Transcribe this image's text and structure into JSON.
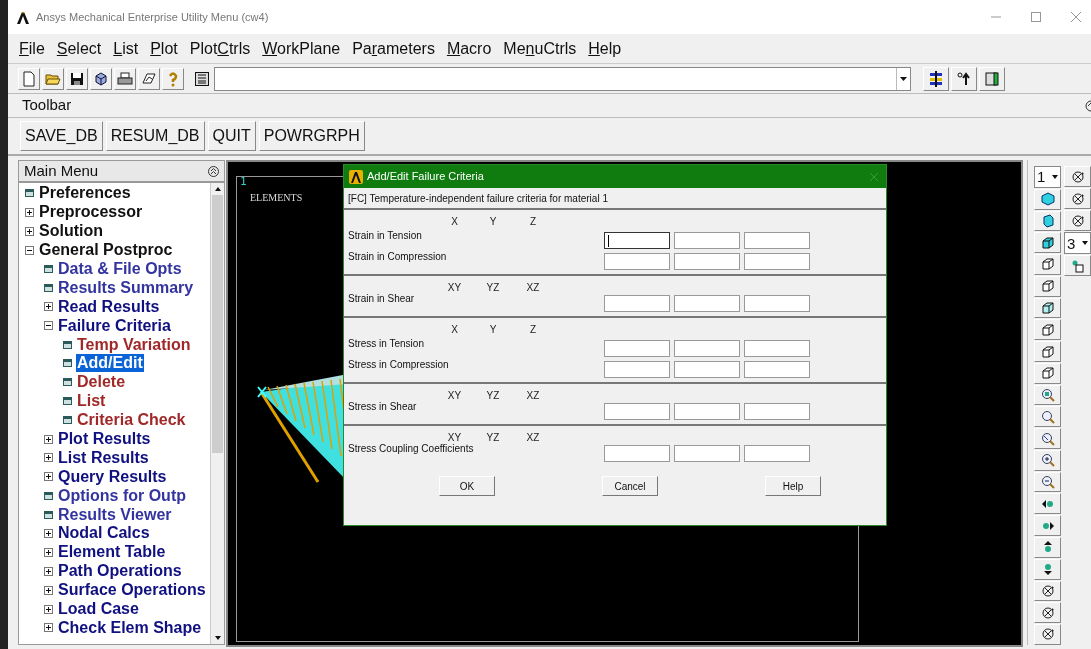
{
  "window": {
    "title": "Ansys Mechanical Enterprise Utility Menu (cw4)"
  },
  "menu_bar": [
    {
      "key": "F",
      "post": "ile"
    },
    {
      "key": "S",
      "post": "elect"
    },
    {
      "key": "L",
      "post": "ist"
    },
    {
      "key": "P",
      "post": "lot"
    },
    {
      "pre": "Plot",
      "key": "C",
      "post": "trls"
    },
    {
      "key": "W",
      "post": "orkPlane"
    },
    {
      "pre": "Pa",
      "key": "r",
      "post": "ameters"
    },
    {
      "key": "M",
      "post": "acro"
    },
    {
      "pre": "Me",
      "key": "n",
      "post": "uCtrls"
    },
    {
      "key": "H",
      "post": "elp"
    }
  ],
  "toolbar": {
    "title": "Toolbar",
    "buttons": [
      "SAVE_DB",
      "RESUM_DB",
      "QUIT",
      "POWRGRPH"
    ]
  },
  "main_menu": {
    "title": "Main Menu",
    "items": [
      {
        "label": "Preferences",
        "kind": "function",
        "selected": false
      },
      {
        "label": "Preprocessor",
        "kind": "group",
        "expanded": false,
        "selected": false
      },
      {
        "label": "Solution",
        "kind": "group",
        "expanded": false,
        "selected": false
      },
      {
        "label": "General Postproc",
        "kind": "group",
        "expanded": true,
        "selected": false,
        "children": [
          {
            "label": "Data & File Opts",
            "kind": "function",
            "selected": false
          },
          {
            "label": "Results Summary",
            "kind": "function",
            "selected": false
          },
          {
            "label": "Read Results",
            "kind": "group",
            "expanded": false,
            "selected": false
          },
          {
            "label": "Failure Criteria",
            "kind": "group",
            "expanded": true,
            "selected": false,
            "children": [
              {
                "label": "Temp Variation",
                "kind": "function",
                "selected": false
              },
              {
                "label": "Add/Edit",
                "kind": "function",
                "selected": true
              },
              {
                "label": "Delete",
                "kind": "function",
                "selected": false
              },
              {
                "label": "List",
                "kind": "function",
                "selected": false
              },
              {
                "label": "Criteria Check",
                "kind": "function",
                "selected": false
              }
            ]
          },
          {
            "label": "Plot Results",
            "kind": "group",
            "expanded": false,
            "selected": false
          },
          {
            "label": "List Results",
            "kind": "group",
            "expanded": false,
            "selected": false
          },
          {
            "label": "Query Results",
            "kind": "group",
            "expanded": false,
            "selected": false
          },
          {
            "label": "Options for Outp",
            "kind": "function",
            "selected": false
          },
          {
            "label": "Results Viewer",
            "kind": "function",
            "selected": false
          },
          {
            "label": "Nodal Calcs",
            "kind": "group",
            "expanded": false,
            "selected": false
          },
          {
            "label": "Element Table",
            "kind": "group",
            "expanded": false,
            "selected": false
          },
          {
            "label": "Path Operations",
            "kind": "group",
            "expanded": false,
            "selected": false
          },
          {
            "label": "Surface Operations",
            "kind": "group",
            "expanded": false,
            "selected": false
          },
          {
            "label": "Load Case",
            "kind": "group",
            "expanded": false,
            "selected": false
          },
          {
            "label": "Check Elem Shape",
            "kind": "group",
            "expanded": false,
            "selected": false
          }
        ]
      }
    ]
  },
  "graphics": {
    "window_number": "1",
    "label": "ELEMENTS"
  },
  "view_toolbar": {
    "window_selector": "1",
    "view_selector": "3"
  },
  "dialog": {
    "title": "Add/Edit Failure Criteria",
    "subtitle": "[FC] Temperature-independent failure criteria for material 1",
    "sections": [
      {
        "axes": [
          "X",
          "Y",
          "Z"
        ],
        "rows": [
          {
            "label": "Strain in Tension",
            "fields": [
              {
                "focused": true
              },
              {
                "focused": false
              },
              {
                "focused": false
              }
            ]
          },
          {
            "label": "Strain in Compression",
            "fields": [
              {
                "focused": false
              },
              {
                "focused": false
              },
              {
                "focused": false
              }
            ]
          }
        ]
      },
      {
        "axes": [
          "XY",
          "YZ",
          "XZ"
        ],
        "rows": [
          {
            "label": "Strain in Shear",
            "fields": [
              {
                "focused": false
              },
              {
                "focused": false
              },
              {
                "focused": false
              }
            ]
          }
        ]
      },
      {
        "axes": [
          "X",
          "Y",
          "Z"
        ],
        "rows": [
          {
            "label": "Stress in Tension",
            "fields": [
              {
                "focused": false
              },
              {
                "focused": false
              },
              {
                "focused": false
              }
            ]
          },
          {
            "label": "Stress in Compression",
            "fields": [
              {
                "focused": false
              },
              {
                "focused": false
              },
              {
                "focused": false
              }
            ]
          }
        ]
      },
      {
        "axes": [
          "XY",
          "YZ",
          "XZ"
        ],
        "rows": [
          {
            "label": "Stress in Shear",
            "fields": [
              {
                "focused": false
              },
              {
                "focused": false
              },
              {
                "focused": false
              }
            ]
          }
        ]
      },
      {
        "axes": [
          "XY",
          "YZ",
          "XZ"
        ],
        "rows": [
          {
            "label": "Stress Coupling Coefficients",
            "fields": [
              {
                "focused": false
              },
              {
                "focused": false
              },
              {
                "focused": false
              }
            ]
          }
        ]
      }
    ],
    "buttons": [
      "OK",
      "Cancel",
      "Help"
    ]
  }
}
